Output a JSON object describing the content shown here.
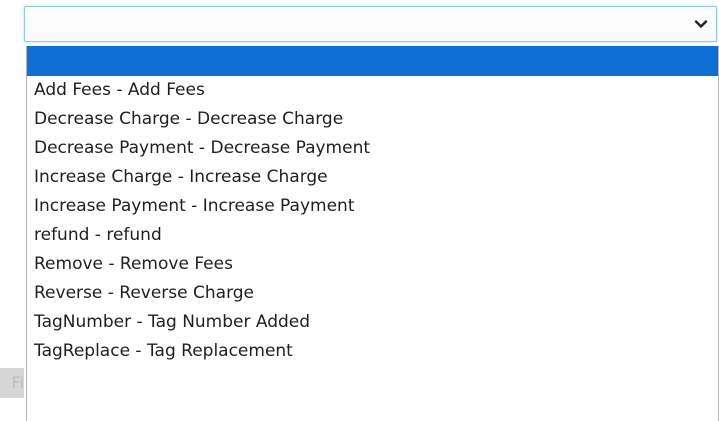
{
  "select": {
    "value": "",
    "chevron_icon": "chevron-down-icon"
  },
  "dropdown": {
    "options": [
      "",
      "Add Fees - Add Fees",
      "Decrease Charge - Decrease Charge",
      "Decrease Payment - Decrease Payment",
      "Increase Charge - Increase Charge",
      "Increase Payment - Increase Payment",
      "refund - refund",
      "Remove - Remove Fees",
      "Reverse - Reverse Charge",
      "TagNumber - Tag Number Added",
      "TagReplace - Tag Replacement"
    ],
    "highlight_color": "#0f6fd6"
  },
  "background": {
    "obscured_text": "Fi"
  }
}
